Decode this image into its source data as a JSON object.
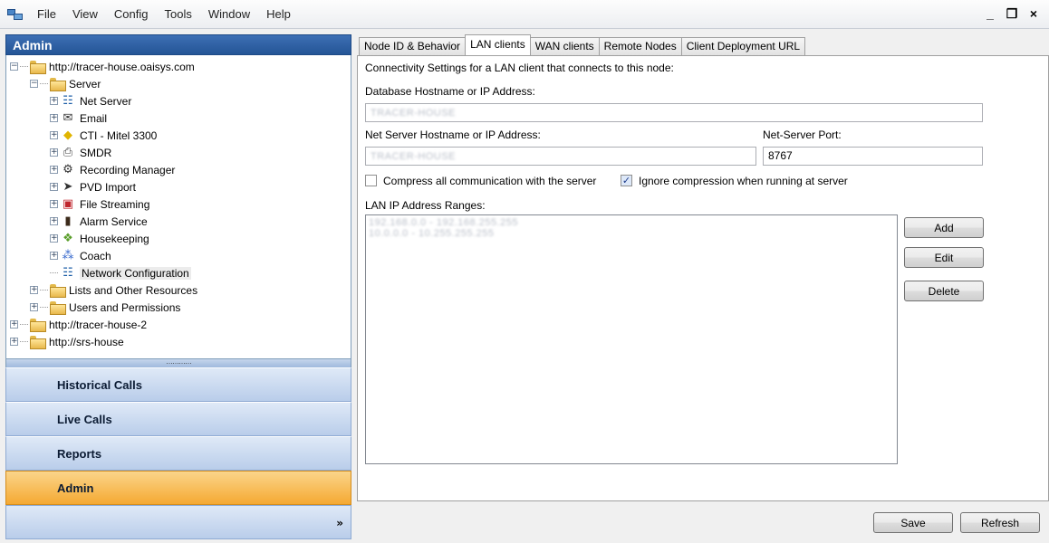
{
  "menu": {
    "items": [
      "File",
      "View",
      "Config",
      "Tools",
      "Window",
      "Help"
    ],
    "controls": [
      "_",
      "ฮ",
      "×"
    ]
  },
  "left": {
    "header": "Admin",
    "tree": {
      "root1": "http://tracer-house.oaisys.com",
      "server": "Server",
      "server_items": [
        {
          "label": "Net Server",
          "icon": "network-icon"
        },
        {
          "label": "Email",
          "icon": "email-icon"
        },
        {
          "label": "CTI - Mitel 3300",
          "icon": "cti-icon"
        },
        {
          "label": "SMDR",
          "icon": "smdr-icon"
        },
        {
          "label": "Recording Manager",
          "icon": "recording-icon"
        },
        {
          "label": "PVD Import",
          "icon": "import-icon"
        },
        {
          "label": "File Streaming",
          "icon": "streaming-icon"
        },
        {
          "label": "Alarm Service",
          "icon": "alarm-icon"
        },
        {
          "label": "Housekeeping",
          "icon": "housekeeping-icon"
        },
        {
          "label": "Coach",
          "icon": "coach-icon"
        }
      ],
      "network_config": "Network Configuration",
      "lists": "Lists and Other Resources",
      "users": "Users and Permissions",
      "root2": "http://tracer-house-2",
      "root3": "http://srs-house"
    },
    "splitter": "…………",
    "nav": [
      "Historical Calls",
      "Live Calls",
      "Reports",
      "Admin"
    ],
    "nav_active": "Admin",
    "nav_chevron": "»"
  },
  "right": {
    "tabs": [
      "Node ID & Behavior",
      "LAN clients",
      "WAN clients",
      "Remote Nodes",
      "Client Deployment URL"
    ],
    "active_tab": "LAN clients",
    "intro": "Connectivity Settings for a LAN client that connects to this node:",
    "db_label": "Database Hostname or IP Address:",
    "db_value": "TRACER-HOUSE",
    "net_label": "Net Server Hostname or IP Address:",
    "net_value": "TRACER-HOUSE",
    "port_label": "Net-Server Port:",
    "port_value": "8767",
    "compress_label": "Compress all communication with the server",
    "compress_checked": false,
    "ignore_label": "Ignore compression when running at server",
    "ignore_checked": true,
    "ranges_label": "LAN IP Address Ranges:",
    "ranges": [
      "192.168.0.0 - 192.168.255.255",
      "10.0.0.0 - 10.255.255.255"
    ],
    "add": "Add",
    "edit": "Edit",
    "delete": "Delete",
    "save": "Save",
    "refresh": "Refresh"
  }
}
